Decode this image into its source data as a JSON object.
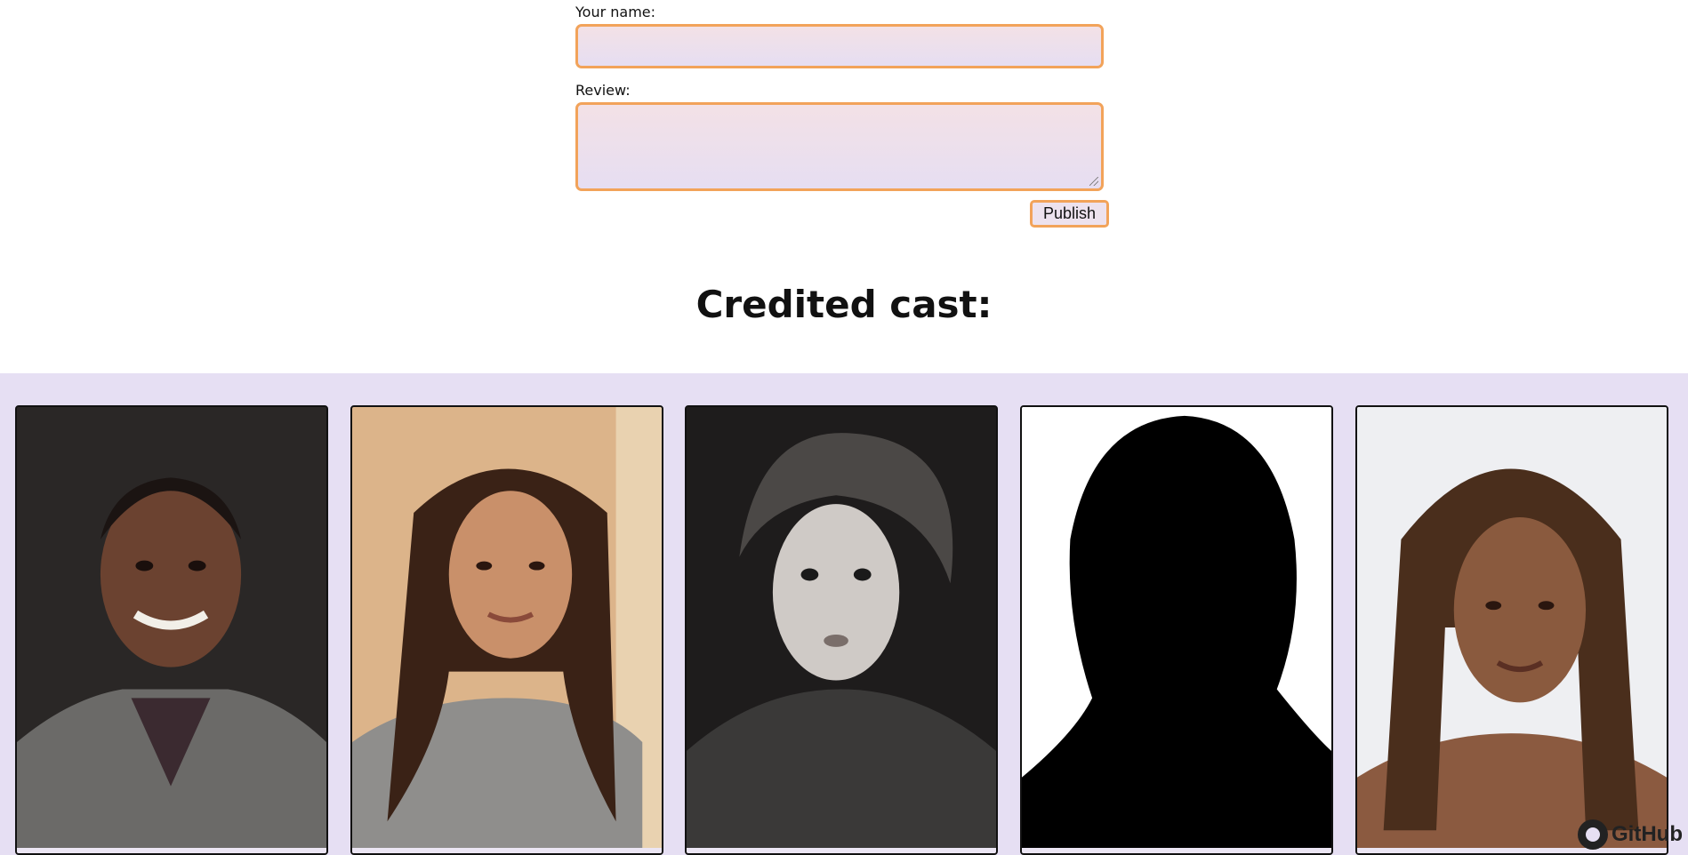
{
  "form": {
    "name_label": "Your name:",
    "name_value": "",
    "review_label": "Review:",
    "review_value": "",
    "publish_label": "Publish"
  },
  "cast": {
    "heading": "Credited cast:",
    "members": [
      {
        "photo": "portrait-man-grey-blazer"
      },
      {
        "photo": "portrait-woman-wavy-hair"
      },
      {
        "photo": "portrait-young-man-bw"
      },
      {
        "photo": "silhouette-placeholder"
      },
      {
        "photo": "portrait-young-woman-dreadlocks"
      }
    ]
  },
  "footer": {
    "github_label": "GitHub"
  },
  "colors": {
    "accent_border": "#f2a35a",
    "field_fill_top": "#f3e1e6",
    "field_fill_bottom": "#e6def2",
    "cast_band": "#e6dff3"
  }
}
